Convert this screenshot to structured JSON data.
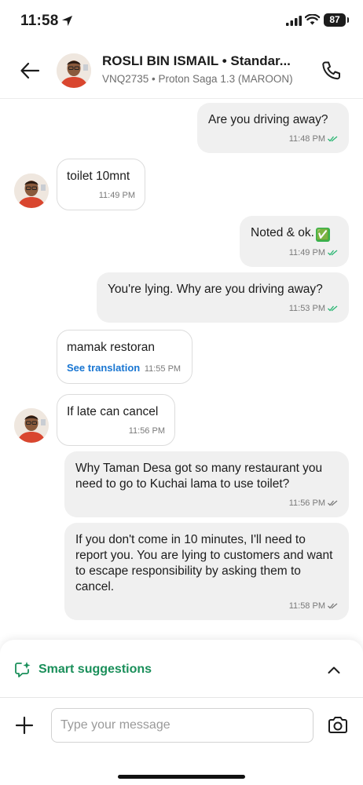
{
  "status_bar": {
    "time": "11:58",
    "battery": "87"
  },
  "header": {
    "name": "ROSLI BIN ISMAIL • Standar...",
    "subtitle": "VNQ2735 • Proton Saga 1.3 (MAROON)"
  },
  "messages": [
    {
      "direction": "out",
      "text": "Are you driving away?",
      "time": "11:48 PM",
      "tick_color": "#2bb673"
    },
    {
      "direction": "in",
      "text": "toilet 10mnt",
      "time": "11:49 PM",
      "avatar": true
    },
    {
      "direction": "out",
      "text": "Noted & ok.",
      "emoji": "✅",
      "time": "11:49 PM",
      "tick_color": "#2bb673"
    },
    {
      "direction": "out",
      "text": "You're lying. Why are you driving away?",
      "time": "11:53 PM",
      "tick_color": "#2bb673"
    },
    {
      "direction": "in",
      "text": "mamak restoran",
      "link": "See translation",
      "time": "11:55 PM",
      "avatar": false
    },
    {
      "direction": "in",
      "text": "If late can cancel",
      "time": "11:56 PM",
      "avatar": true
    },
    {
      "direction": "out",
      "text": "Why Taman Desa got so many restaurant you need to go to Kuchai lama to use toilet?",
      "time": "11:56 PM",
      "tick_color": "#7a7a7a"
    },
    {
      "direction": "out",
      "text": "If you don't come in 10 minutes, I'll need to report you. You are lying to customers and want to escape responsibility by asking them to cancel.",
      "time": "11:58 PM",
      "tick_color": "#7a7a7a"
    }
  ],
  "smart_suggestions": {
    "label": "Smart suggestions"
  },
  "composer": {
    "placeholder": "Type your message"
  },
  "colors": {
    "accent_green": "#1a8f5a",
    "link_blue": "#1976d2",
    "outgoing_bubble": "#f0f0f0"
  }
}
